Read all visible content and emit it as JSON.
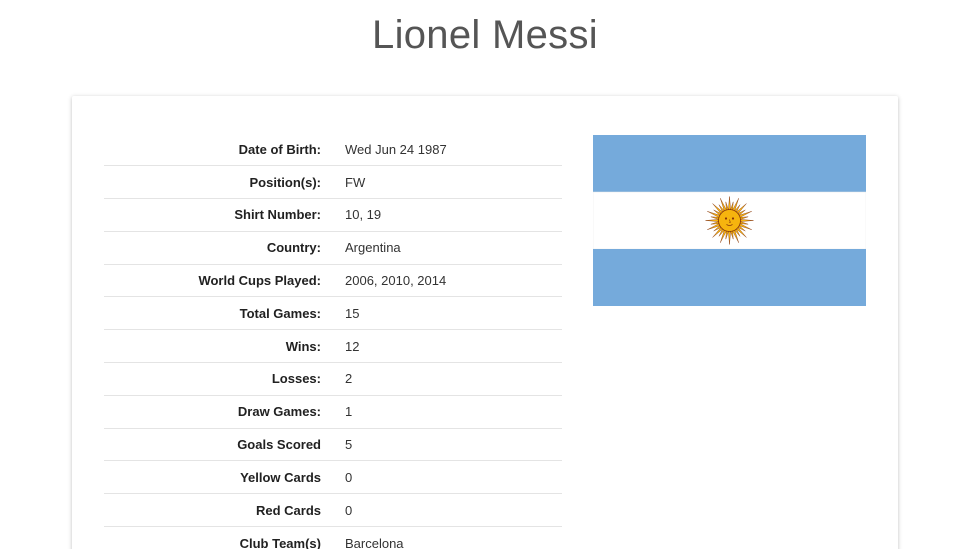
{
  "player": {
    "name": "Lionel Messi"
  },
  "stats": [
    {
      "label": "Date of Birth:",
      "value": "Wed Jun 24 1987"
    },
    {
      "label": "Position(s):",
      "value": "FW"
    },
    {
      "label": "Shirt Number:",
      "value": "10, 19"
    },
    {
      "label": "Country:",
      "value": "Argentina"
    },
    {
      "label": "World Cups Played:",
      "value": "2006, 2010, 2014"
    },
    {
      "label": "Total Games:",
      "value": "15"
    },
    {
      "label": "Wins:",
      "value": "12"
    },
    {
      "label": "Losses:",
      "value": "2"
    },
    {
      "label": "Draw Games:",
      "value": "1"
    },
    {
      "label": "Goals Scored",
      "value": "5"
    },
    {
      "label": "Yellow Cards",
      "value": "0"
    },
    {
      "label": "Red Cards",
      "value": "0"
    },
    {
      "label": "Club Team(s)",
      "value": "Barcelona"
    }
  ],
  "flag": {
    "icon": "argentina-flag",
    "colors": {
      "blue": "#75AADB",
      "white": "#FFFFFF",
      "sun": "#F6B40E",
      "sun_stroke": "#85340A"
    }
  }
}
